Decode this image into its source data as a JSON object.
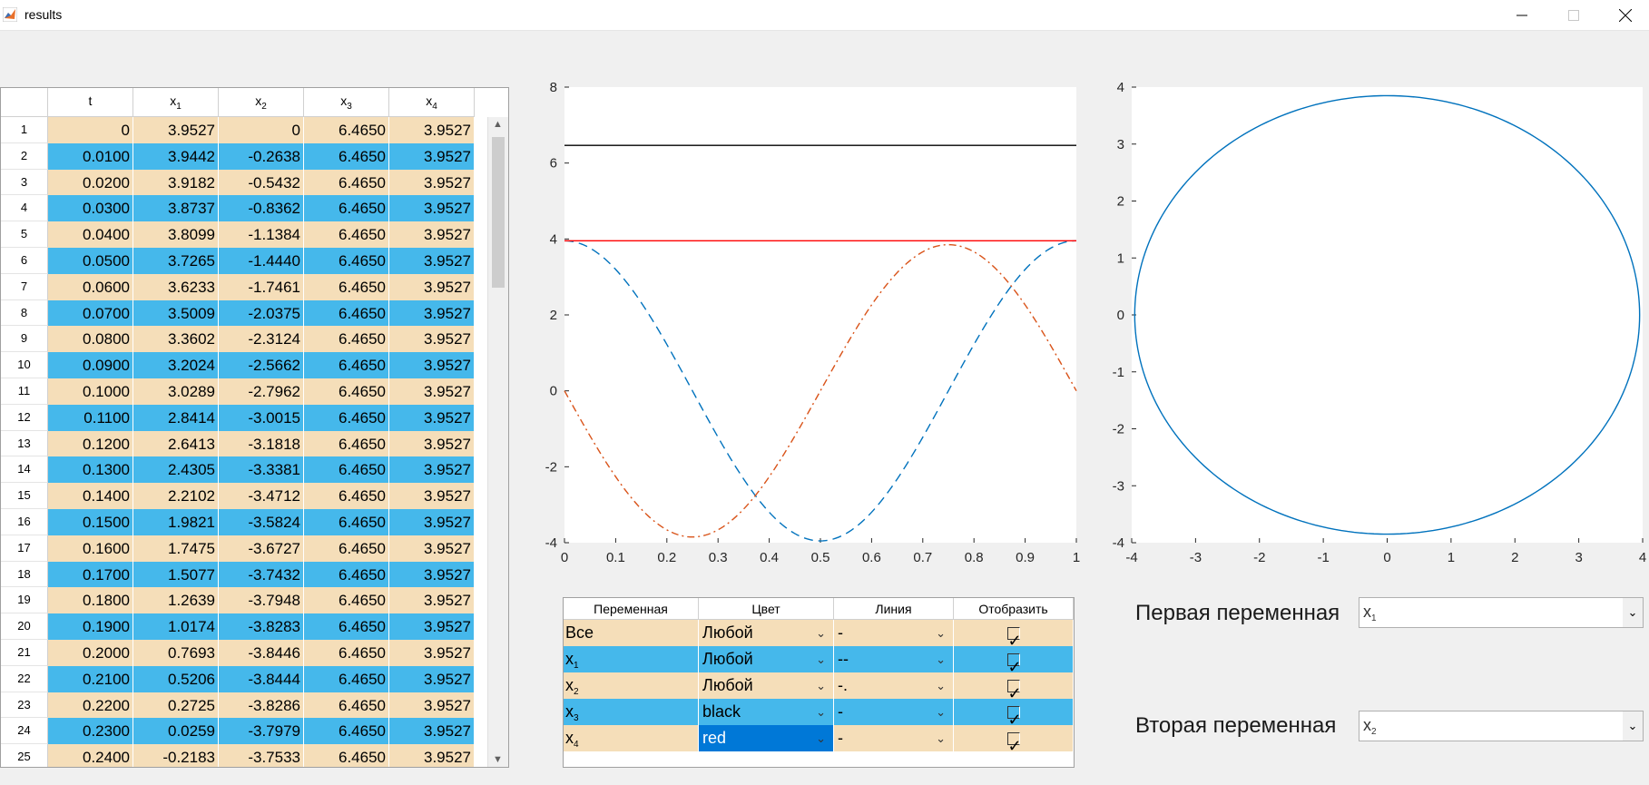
{
  "window": {
    "title": "results"
  },
  "table": {
    "headers": [
      "t",
      "x",
      "x",
      "x",
      "x"
    ],
    "header_subs": [
      "",
      "1",
      "2",
      "3",
      "4"
    ],
    "rows": [
      [
        "1",
        "0",
        "3.9527",
        "0",
        "6.4650",
        "3.9527"
      ],
      [
        "2",
        "0.0100",
        "3.9442",
        "-0.2638",
        "6.4650",
        "3.9527"
      ],
      [
        "3",
        "0.0200",
        "3.9182",
        "-0.5432",
        "6.4650",
        "3.9527"
      ],
      [
        "4",
        "0.0300",
        "3.8737",
        "-0.8362",
        "6.4650",
        "3.9527"
      ],
      [
        "5",
        "0.0400",
        "3.8099",
        "-1.1384",
        "6.4650",
        "3.9527"
      ],
      [
        "6",
        "0.0500",
        "3.7265",
        "-1.4440",
        "6.4650",
        "3.9527"
      ],
      [
        "7",
        "0.0600",
        "3.6233",
        "-1.7461",
        "6.4650",
        "3.9527"
      ],
      [
        "8",
        "0.0700",
        "3.5009",
        "-2.0375",
        "6.4650",
        "3.9527"
      ],
      [
        "9",
        "0.0800",
        "3.3602",
        "-2.3124",
        "6.4650",
        "3.9527"
      ],
      [
        "10",
        "0.0900",
        "3.2024",
        "-2.5662",
        "6.4650",
        "3.9527"
      ],
      [
        "11",
        "0.1000",
        "3.0289",
        "-2.7962",
        "6.4650",
        "3.9527"
      ],
      [
        "12",
        "0.1100",
        "2.8414",
        "-3.0015",
        "6.4650",
        "3.9527"
      ],
      [
        "13",
        "0.1200",
        "2.6413",
        "-3.1818",
        "6.4650",
        "3.9527"
      ],
      [
        "14",
        "0.1300",
        "2.4305",
        "-3.3381",
        "6.4650",
        "3.9527"
      ],
      [
        "15",
        "0.1400",
        "2.2102",
        "-3.4712",
        "6.4650",
        "3.9527"
      ],
      [
        "16",
        "0.1500",
        "1.9821",
        "-3.5824",
        "6.4650",
        "3.9527"
      ],
      [
        "17",
        "0.1600",
        "1.7475",
        "-3.6727",
        "6.4650",
        "3.9527"
      ],
      [
        "18",
        "0.1700",
        "1.5077",
        "-3.7432",
        "6.4650",
        "3.9527"
      ],
      [
        "19",
        "0.1800",
        "1.2639",
        "-3.7948",
        "6.4650",
        "3.9527"
      ],
      [
        "20",
        "0.1900",
        "1.0174",
        "-3.8283",
        "6.4650",
        "3.9527"
      ],
      [
        "21",
        "0.2000",
        "0.7693",
        "-3.8446",
        "6.4650",
        "3.9527"
      ],
      [
        "22",
        "0.2100",
        "0.5206",
        "-3.8444",
        "6.4650",
        "3.9527"
      ],
      [
        "23",
        "0.2200",
        "0.2725",
        "-3.8286",
        "6.4650",
        "3.9527"
      ],
      [
        "24",
        "0.2300",
        "0.0259",
        "-3.7979",
        "6.4650",
        "3.9527"
      ],
      [
        "25",
        "0.2400",
        "-0.2183",
        "-3.7533",
        "6.4650",
        "3.9527"
      ]
    ]
  },
  "settings": {
    "headers": [
      "Переменная",
      "Цвет",
      "Линия",
      "Отобразить"
    ],
    "rows": [
      {
        "var": "Все",
        "sub": "",
        "color": "Любой",
        "line": "-",
        "show": "✓"
      },
      {
        "var": "x",
        "sub": "1",
        "color": "Любой",
        "line": "--",
        "show": "✓"
      },
      {
        "var": "x",
        "sub": "2",
        "color": "Любой",
        "line": "-.",
        "show": "✓"
      },
      {
        "var": "x",
        "sub": "3",
        "color": "black",
        "line": "-",
        "show": "✓"
      },
      {
        "var": "x",
        "sub": "4",
        "color": "red",
        "line": "-",
        "show": "✓"
      }
    ]
  },
  "selectors": {
    "first_label": "Первая переменная",
    "first_value": "x",
    "first_sub": "1",
    "second_label": "Вторая переменная",
    "second_value": "x",
    "second_sub": "2"
  },
  "chart_data": [
    {
      "type": "line",
      "xlim": [
        0,
        1
      ],
      "ylim": [
        -4,
        8
      ],
      "xticks": [
        "0",
        "0.1",
        "0.2",
        "0.3",
        "0.4",
        "0.5",
        "0.6",
        "0.7",
        "0.8",
        "0.9",
        "1"
      ],
      "yticks": [
        "-4",
        "-2",
        "0",
        "2",
        "4",
        "6",
        "8"
      ],
      "series": [
        {
          "color": "#0072bd",
          "style": "--",
          "kind": "x1",
          "amplitude": 3.9527,
          "period": 1
        },
        {
          "color": "#d95319",
          "style": "-.",
          "kind": "x2",
          "amplitude": 3.85,
          "period": 1
        },
        {
          "color": "#000000",
          "style": "-",
          "kind": "const",
          "value": 6.465
        },
        {
          "color": "#ff0000",
          "style": "-",
          "kind": "const",
          "value": 3.9527
        }
      ]
    },
    {
      "type": "line",
      "xlim": [
        -4,
        4
      ],
      "ylim": [
        -4,
        4
      ],
      "xticks": [
        "-4",
        "-3",
        "-2",
        "-1",
        "0",
        "1",
        "2",
        "3",
        "4"
      ],
      "yticks": [
        "-4",
        "-3",
        "-2",
        "-1",
        "0",
        "1",
        "2",
        "3",
        "4"
      ],
      "series": [
        {
          "color": "#0072bd",
          "style": "-",
          "kind": "phase",
          "amplitude_x": 3.9527,
          "amplitude_y": 3.85
        }
      ]
    }
  ]
}
